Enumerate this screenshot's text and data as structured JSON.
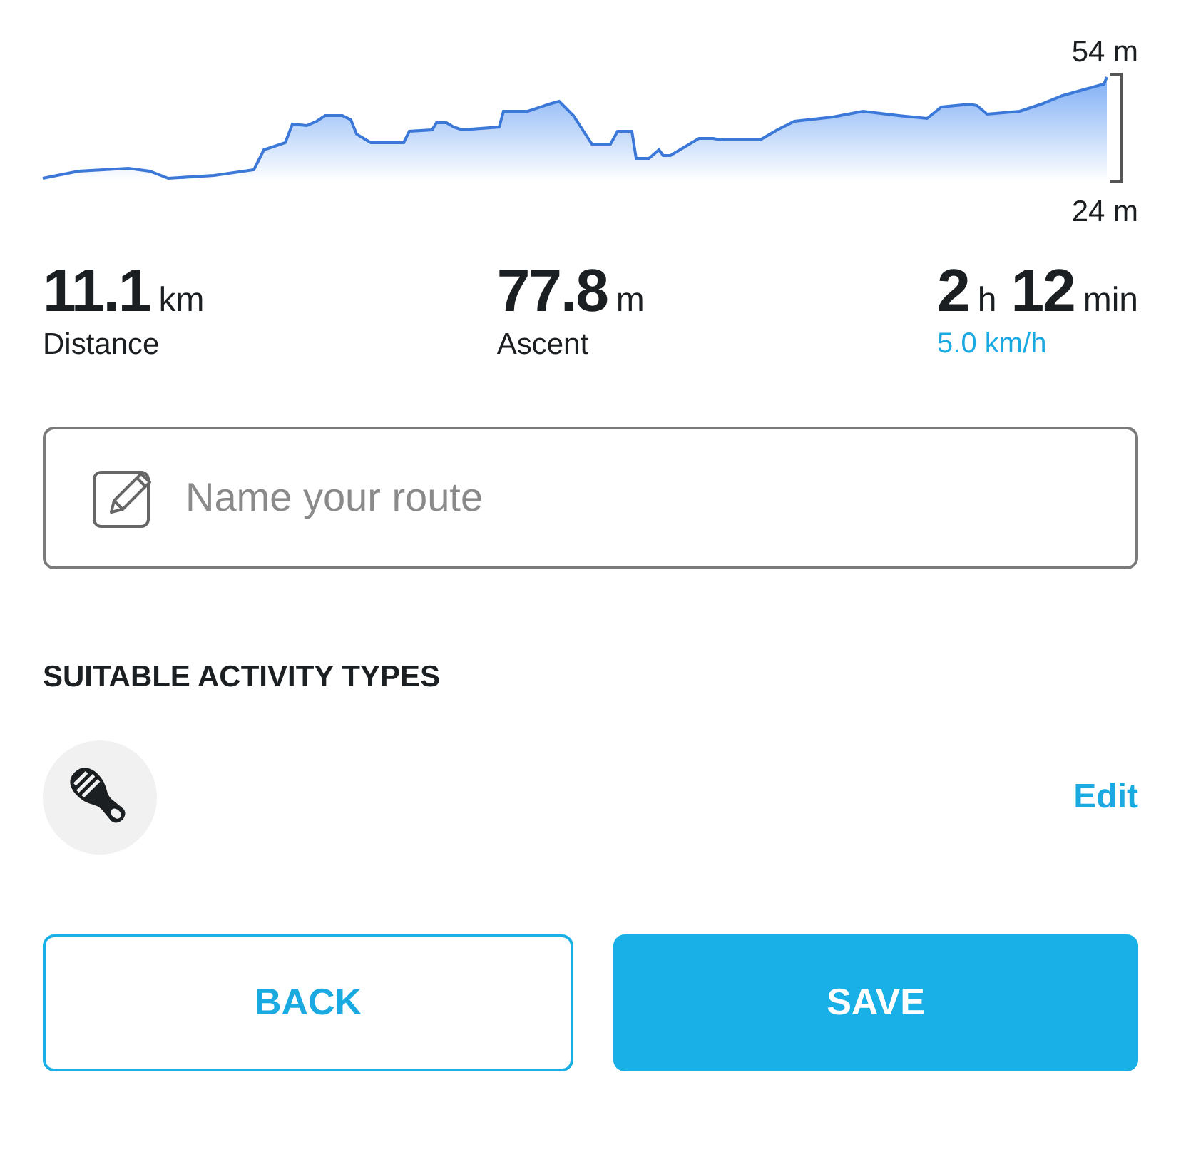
{
  "elevation_profile": {
    "max_label": "54 m",
    "min_label": "24 m"
  },
  "stats": [
    {
      "kind": "total",
      "parts": [
        {
          "value": "11.1",
          "unit": "km"
        }
      ],
      "caption": "Distance"
    },
    {
      "kind": "total",
      "parts": [
        {
          "value": "77.8",
          "unit": "m"
        }
      ],
      "caption": "Ascent"
    },
    {
      "kind": "pace",
      "parts": [
        {
          "value": "2",
          "unit": "h"
        },
        {
          "value": "12",
          "unit": "min"
        }
      ],
      "caption": "5.0 km/h"
    }
  ],
  "route_name": {
    "placeholder": "Name your route"
  },
  "activity_section": {
    "title": "SUITABLE ACTIVITY TYPES",
    "edit": "Edit"
  },
  "buttons": [
    {
      "label": "BACK",
      "kind": "outline"
    },
    {
      "label": "SAVE",
      "kind": "primary"
    }
  ]
}
